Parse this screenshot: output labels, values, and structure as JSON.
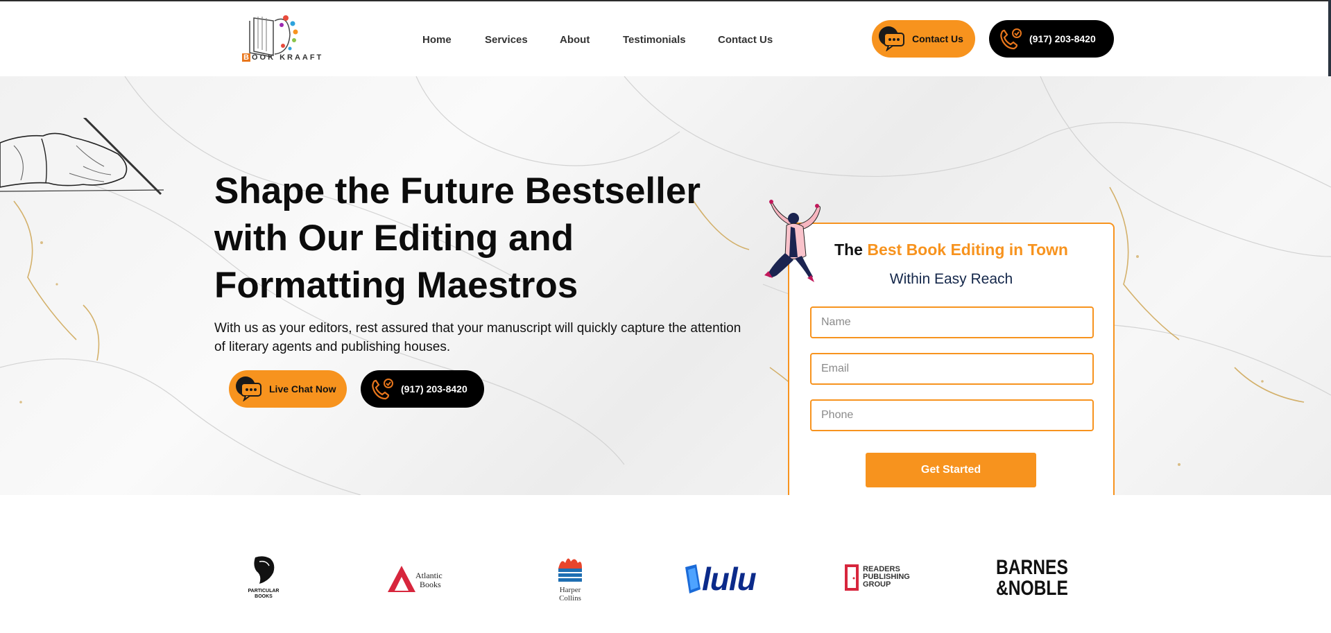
{
  "header": {
    "logo": {
      "text_prefix": "B",
      "text_rest": "OOK KRAAFT"
    },
    "nav": [
      {
        "label": "Home"
      },
      {
        "label": "Services"
      },
      {
        "label": "About"
      },
      {
        "label": "Testimonials"
      },
      {
        "label": "Contact Us"
      }
    ],
    "contact_button_label": "Contact Us",
    "phone_button_label": "(917) 203-8420"
  },
  "hero": {
    "headline": "Shape the Future Bestseller with Our Editing and Formatting Maestros",
    "subtext": "With us as your editors, rest assured that your manuscript will quickly capture the attention of literary agents and publishing houses.",
    "chat_button_label": "Live Chat Now",
    "phone_button_label": "(917) 203-8420"
  },
  "form": {
    "title_prefix": "The ",
    "title_accent": "Best Book Editing in Town",
    "subtitle": "Within Easy Reach",
    "name_placeholder": "Name",
    "email_placeholder": "Email",
    "phone_placeholder": "Phone",
    "name_value": "",
    "email_value": "",
    "phone_value": "",
    "submit_label": "Get Started"
  },
  "partners": {
    "particular_books": "PARTICULAR BOOKS",
    "atlantic_line1": "Atlantic",
    "atlantic_line2": "Books",
    "harper_line1": "Harper",
    "harper_line2": "Collins",
    "lulu": "lulu",
    "readers_line1": "READERS",
    "readers_line2": "PUBLISHING",
    "readers_line3": "GROUP",
    "barnes_line1": "BARNES",
    "barnes_line2": "&NOBLE"
  },
  "colors": {
    "accent": "#f7931e",
    "dark": "#000000",
    "navy": "#14274a"
  },
  "icons": [
    "chat-bubble-icon",
    "phone-icon",
    "pen-hand-illustration",
    "jumping-woman-illustration"
  ]
}
